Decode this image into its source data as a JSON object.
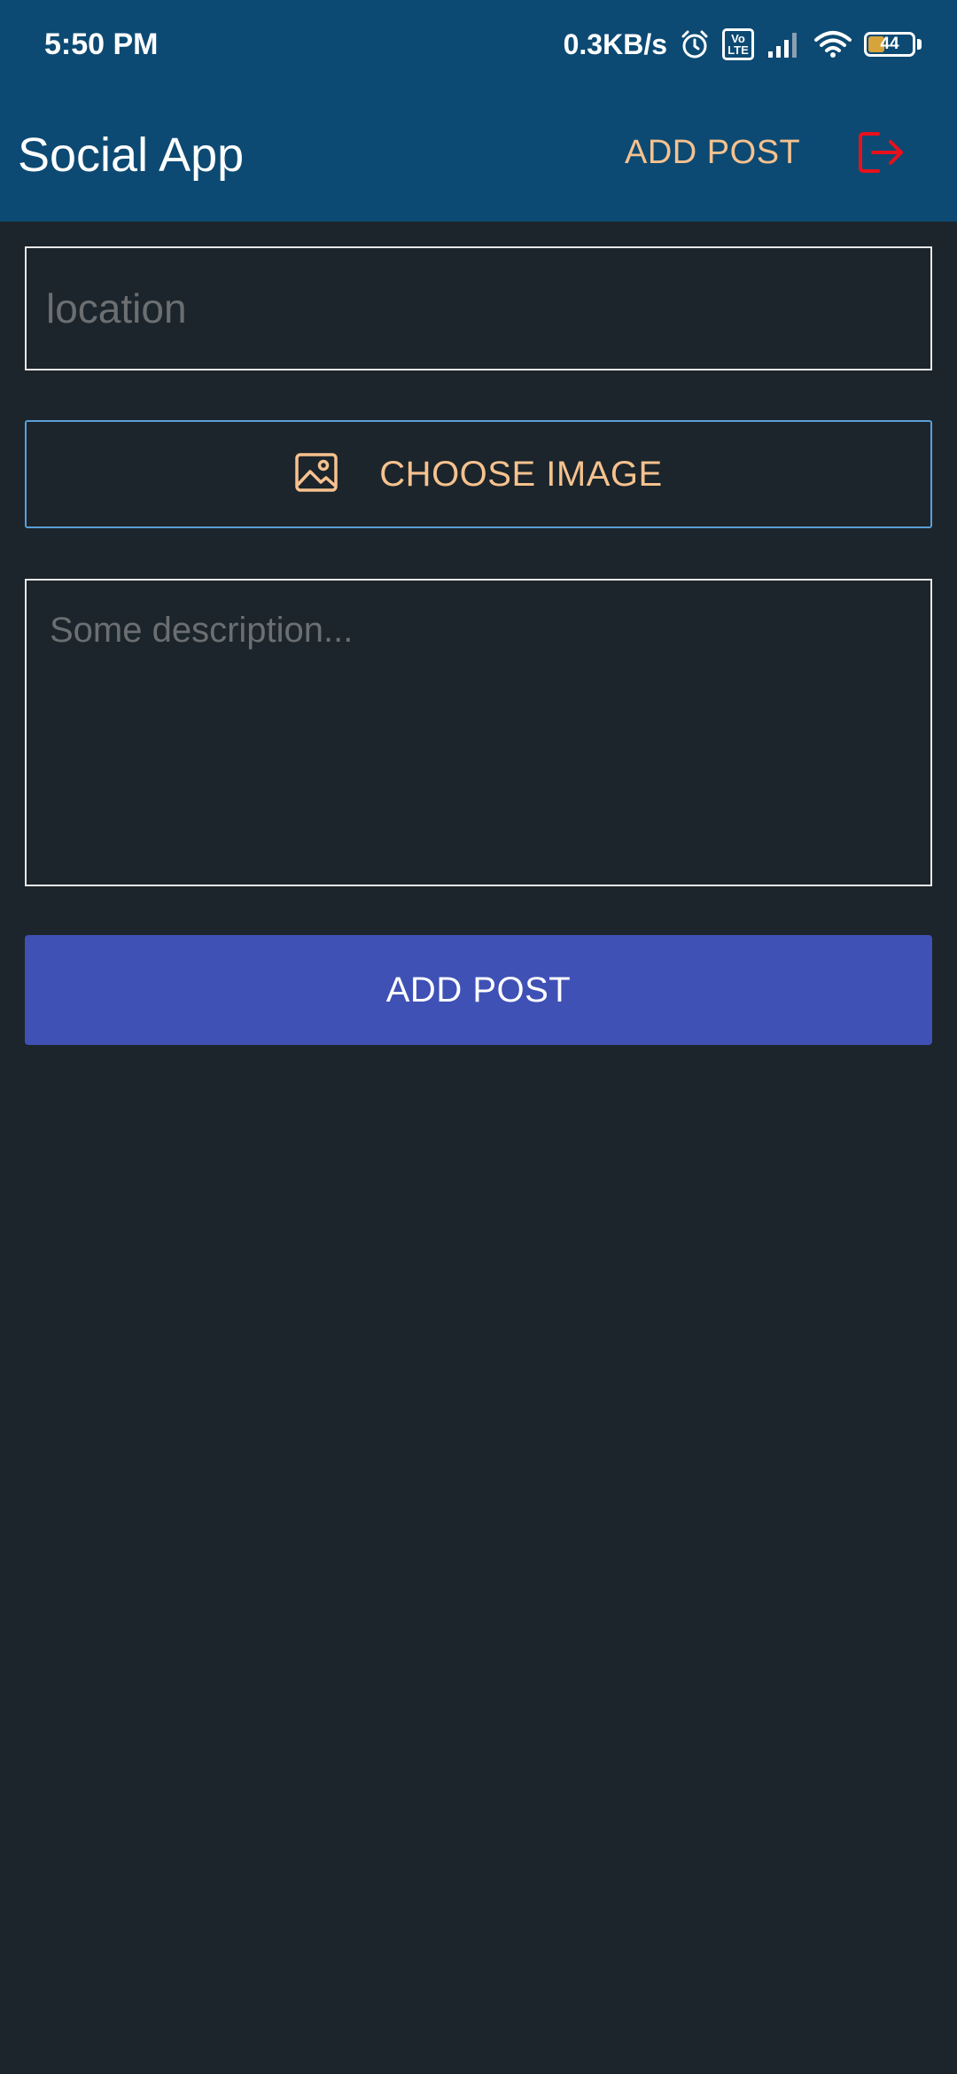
{
  "status_bar": {
    "time": "5:50 PM",
    "net_speed": "0.3KB/s",
    "volte_top": "Vo",
    "volte_bottom": "LTE",
    "battery_level": "44",
    "icons": [
      "alarm-icon",
      "volte-icon",
      "signal-icon",
      "wifi-icon",
      "battery-icon"
    ]
  },
  "app_bar": {
    "title": "Social App",
    "action_label": "ADD POST",
    "logout_icon": "logout-icon"
  },
  "form": {
    "location_placeholder": "location",
    "location_value": "",
    "choose_image_label": "CHOOSE IMAGE",
    "choose_image_icon": "image-icon",
    "description_placeholder": "Some description...",
    "description_value": "",
    "submit_label": "ADD POST"
  },
  "colors": {
    "background": "#1c252b",
    "app_bar": "#0c4a73",
    "accent_text": "#f6c28f",
    "primary_button": "#3f51b5",
    "outline_button_border": "#5a9fd8",
    "logout_icon": "#e8111b"
  }
}
